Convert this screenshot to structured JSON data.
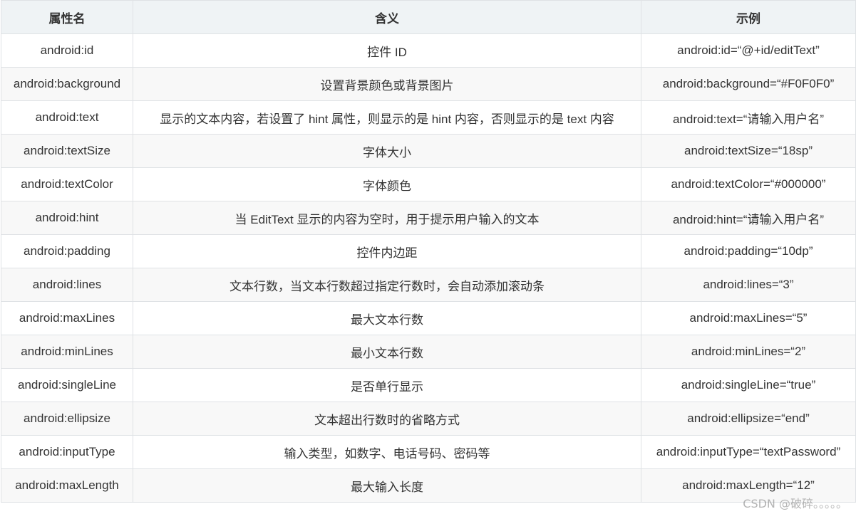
{
  "headers": [
    "属性名",
    "含义",
    "示例"
  ],
  "rows": [
    {
      "attr": "android:id",
      "desc": "控件 ID",
      "example": "android:id=“@+id/editText”"
    },
    {
      "attr": "android:background",
      "desc": "设置背景颜色或背景图片",
      "example": "android:background=“#F0F0F0”"
    },
    {
      "attr": "android:text",
      "desc": "显示的文本内容，若设置了 hint 属性，则显示的是 hint 内容，否则显示的是 text 内容",
      "example": "android:text=“请输入用户名”"
    },
    {
      "attr": "android:textSize",
      "desc": "字体大小",
      "example": "android:textSize=“18sp”"
    },
    {
      "attr": "android:textColor",
      "desc": "字体颜色",
      "example": "android:textColor=“#000000”"
    },
    {
      "attr": "android:hint",
      "desc": "当 EditText 显示的内容为空时，用于提示用户输入的文本",
      "example": "android:hint=“请输入用户名”"
    },
    {
      "attr": "android:padding",
      "desc": "控件内边距",
      "example": "android:padding=“10dp”"
    },
    {
      "attr": "android:lines",
      "desc": "文本行数，当文本行数超过指定行数时，会自动添加滚动条",
      "example": "android:lines=“3”"
    },
    {
      "attr": "android:maxLines",
      "desc": "最大文本行数",
      "example": "android:maxLines=“5”"
    },
    {
      "attr": "android:minLines",
      "desc": "最小文本行数",
      "example": "android:minLines=“2”"
    },
    {
      "attr": "android:singleLine",
      "desc": "是否单行显示",
      "example": "android:singleLine=“true”"
    },
    {
      "attr": "android:ellipsize",
      "desc": "文本超出行数时的省略方式",
      "example": "android:ellipsize=“end”"
    },
    {
      "attr": "android:inputType",
      "desc": "输入类型，如数字、电话号码、密码等",
      "example": "android:inputType=“textPassword”"
    },
    {
      "attr": "android:maxLength",
      "desc": "最大输入长度",
      "example": "android:maxLength=“12”"
    }
  ],
  "watermark": "CSDN @破碎。。。。。"
}
